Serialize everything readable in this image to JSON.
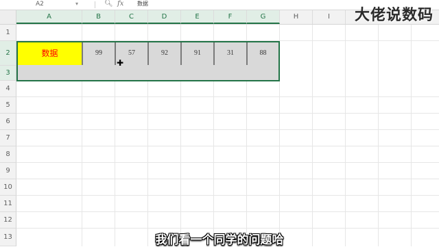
{
  "formula_bar": {
    "name_box": "A2",
    "zoom_icon": "magnify-icon",
    "fx_label": "fx",
    "formula_value": "数据"
  },
  "columns": [
    "A",
    "B",
    "C",
    "D",
    "E",
    "F",
    "G",
    "H",
    "I"
  ],
  "rows": [
    "1",
    "2",
    "3",
    "4",
    "5",
    "6",
    "7",
    "8",
    "9",
    "10",
    "11",
    "12",
    "13"
  ],
  "cells": {
    "A2": "数据",
    "B2": "99",
    "C2": "57",
    "D2": "92",
    "E2": "91",
    "F2": "31",
    "G2": "88"
  },
  "colors": {
    "selection": "#217346",
    "highlight": "#ffff00",
    "label_text": "#ff0000",
    "cell_fill": "#d9d9d9"
  },
  "watermark": "大佬说数码",
  "subtitle": "我们看一个同学的问题哈"
}
